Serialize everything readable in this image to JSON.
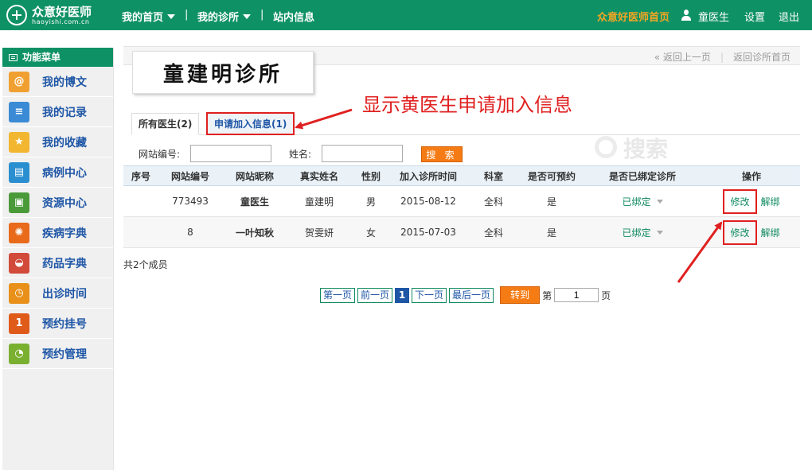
{
  "header": {
    "logo_name": "众意好医师",
    "logo_domain": "haoyishi.com.cn",
    "nav": [
      "我的首页",
      "我的诊所",
      "站内信息"
    ],
    "nav_sep": "|",
    "home_link": "众意好医师首页",
    "user": "童医生",
    "settings": "设置",
    "logout": "退出"
  },
  "sidebar": {
    "title": "功能菜单",
    "items": [
      {
        "label": "我的博文",
        "icon": "blog-icon",
        "color": "#f0a030",
        "glyph": "@"
      },
      {
        "label": "我的记录",
        "icon": "notes-icon",
        "color": "#3a8ad6",
        "glyph": "≡"
      },
      {
        "label": "我的收藏",
        "icon": "favorite-icon",
        "color": "#f2b630",
        "glyph": "★"
      },
      {
        "label": "病例中心",
        "icon": "case-icon",
        "color": "#2a8fd0",
        "glyph": "▤"
      },
      {
        "label": "资源中心",
        "icon": "resource-icon",
        "color": "#4a9a3a",
        "glyph": "▣"
      },
      {
        "label": "疾病字典",
        "icon": "disease-icon",
        "color": "#e86a1a",
        "glyph": "✺"
      },
      {
        "label": "药品字典",
        "icon": "medicine-icon",
        "color": "#d24a3a",
        "glyph": "◒"
      },
      {
        "label": "出诊时间",
        "icon": "clock-icon",
        "color": "#e8901a",
        "glyph": "◷"
      },
      {
        "label": "预约挂号",
        "icon": "register-icon",
        "color": "#e05a1a",
        "glyph": "1"
      },
      {
        "label": "预约管理",
        "icon": "manage-icon",
        "color": "#7ab030",
        "glyph": "◔"
      }
    ]
  },
  "breadcrumb": {
    "back": "« 返回上一页",
    "sep": "|",
    "clinic_home": "返回诊所首页"
  },
  "clinic_name": "童建明诊所",
  "annotation": "显示黄医生申请加入信息",
  "tabs": {
    "all": "所有医生(2)",
    "apply": "申请加入信息(1)"
  },
  "search": {
    "id_label": "网站编号:",
    "name_label": "姓名:",
    "button": "搜 索",
    "watermark": "搜索"
  },
  "table": {
    "columns": [
      "序号",
      "网站编号",
      "网站昵称",
      "真实姓名",
      "性别",
      "加入诊所时间",
      "科室",
      "是否可预约",
      "是否已绑定诊所",
      "操作"
    ],
    "rows": [
      {
        "seq": "",
        "site_id": "773493",
        "nickname": "童医生",
        "real_name": "童建明",
        "gender": "男",
        "join_time": "2015-08-12",
        "dept": "全科",
        "bookable": "是",
        "bound": "已绑定",
        "edit": "修改",
        "unbind": "解绑"
      },
      {
        "seq": "",
        "site_id": "8",
        "nickname": "一叶知秋",
        "real_name": "贺雯妍",
        "gender": "女",
        "join_time": "2015-07-03",
        "dept": "全科",
        "bookable": "是",
        "bound": "已绑定",
        "edit": "修改",
        "unbind": "解绑"
      }
    ]
  },
  "member_count": "共2个成员",
  "pager": {
    "first": "第一页",
    "prev": "前一页",
    "current": "1",
    "next": "下一页",
    "last": "最后一页",
    "goto": "转到",
    "page_prefix": "第",
    "page_value": "1",
    "page_suffix": "页"
  }
}
